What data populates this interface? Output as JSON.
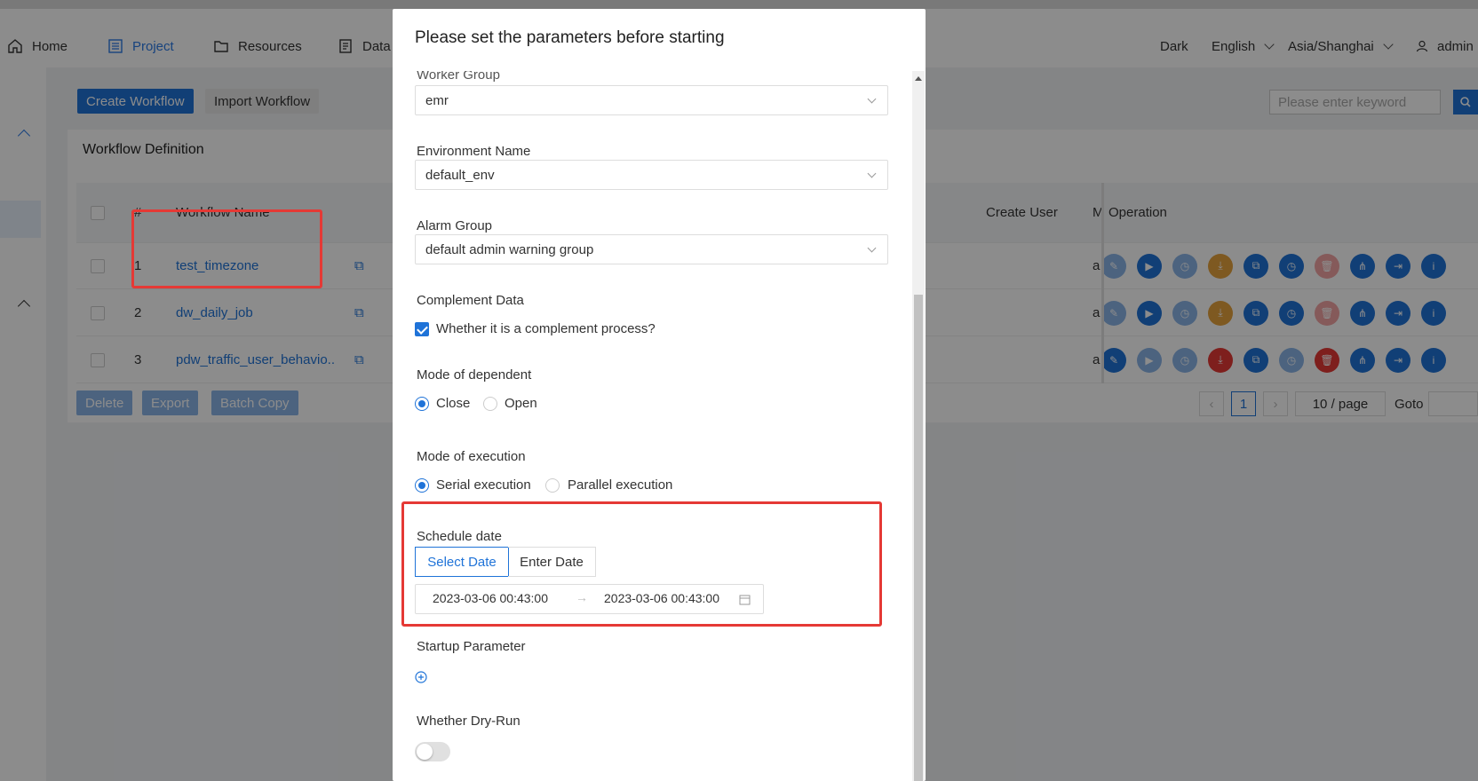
{
  "topnav": {
    "items": [
      {
        "label": "Home",
        "icon": "home-icon"
      },
      {
        "label": "Project",
        "icon": "project-icon",
        "active": true
      },
      {
        "label": "Resources",
        "icon": "folder-icon"
      },
      {
        "label": "Data",
        "icon": "document-icon"
      }
    ],
    "theme": "Dark",
    "language": "English",
    "timezone": "Asia/Shanghai",
    "user": "admin"
  },
  "toolbar": {
    "create_label": "Create Workflow",
    "import_label": "Import Workflow",
    "search_placeholder": "Please enter keyword"
  },
  "card": {
    "title": "Workflow Definition",
    "columns": {
      "index": "#",
      "name": "Workflow Name",
      "create_user": "Create User",
      "m": "M",
      "operation": "Operation"
    },
    "rows": [
      {
        "index": "1",
        "name": "test_timezone",
        "m": "a"
      },
      {
        "index": "2",
        "name": "dw_daily_job",
        "m": "a"
      },
      {
        "index": "3",
        "name": "pdw_traffic_user_behavio..",
        "m": "a"
      }
    ],
    "bulk": {
      "delete": "Delete",
      "export": "Export",
      "batch_copy": "Batch Copy"
    },
    "pager": {
      "page": "1",
      "size": "10 / page",
      "goto": "Goto"
    }
  },
  "modal": {
    "title": "Please set the parameters before starting",
    "worker_group_label": "Worker Group",
    "worker_group_value": "emr",
    "env_label": "Environment Name",
    "env_value": "default_env",
    "alarm_label": "Alarm Group",
    "alarm_value": "default admin warning group",
    "complement_label": "Complement Data",
    "complement_check": "Whether it is a complement process?",
    "dependent_label": "Mode of dependent",
    "dependent_close": "Close",
    "dependent_open": "Open",
    "execution_label": "Mode of execution",
    "execution_serial": "Serial execution",
    "execution_parallel": "Parallel execution",
    "schedule_label": "Schedule date",
    "select_date": "Select Date",
    "enter_date": "Enter Date",
    "start_date": "2023-03-06 00:43:00",
    "end_date": "2023-03-06 00:43:00",
    "startup_label": "Startup Parameter",
    "dryrun_label": "Whether Dry-Run"
  },
  "colors": {
    "primary": "#1f73d8",
    "highlight": "#e53935",
    "op_blue": "#1f73d8",
    "op_orange": "#e6a23c",
    "op_red": "#e53935"
  }
}
